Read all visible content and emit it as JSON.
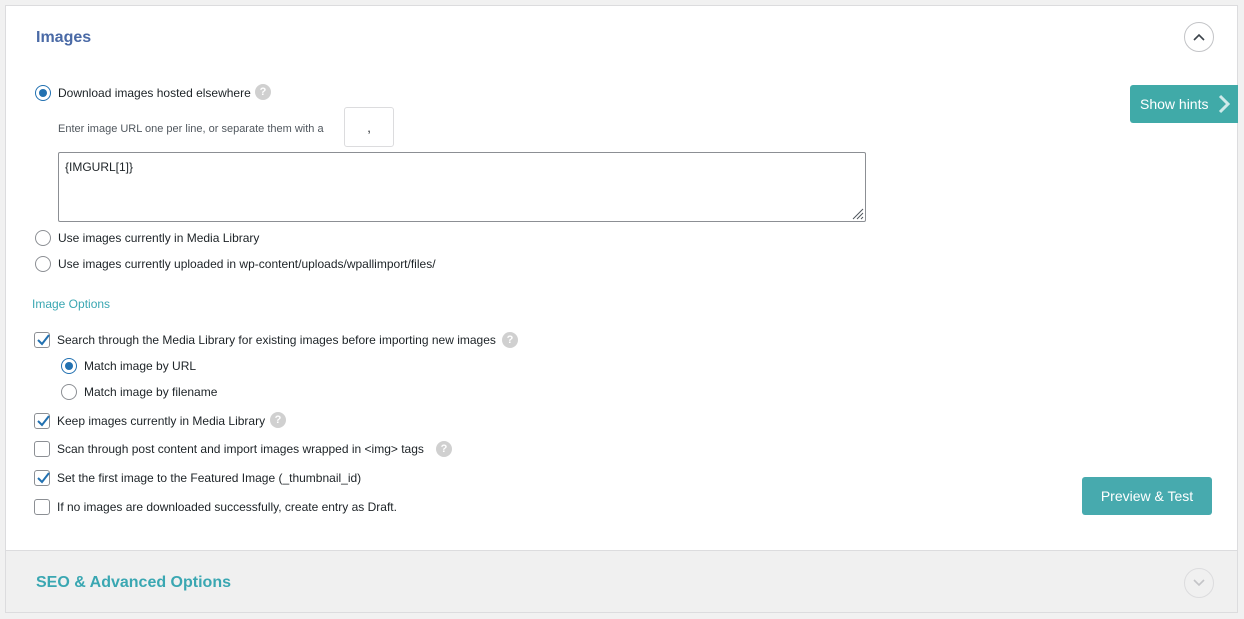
{
  "images_panel": {
    "title": "Images",
    "source_options": {
      "download_label": "Download images hosted elsewhere",
      "download_selected": true,
      "url_hint": "Enter image URL one per line, or separate them with a",
      "separator_value": ",",
      "urls_value": "{IMGURL[1]}",
      "media_library_label": "Use images currently in Media Library",
      "uploaded_label": "Use images currently uploaded in wp-content/uploads/wpallimport/files/"
    },
    "image_options": {
      "heading": "Image Options",
      "search_media_label": "Search through the Media Library for existing images before importing new images",
      "search_media_checked": true,
      "match_url_label": "Match image by URL",
      "match_url_selected": true,
      "match_filename_label": "Match image by filename",
      "keep_images_label": "Keep images currently in Media Library",
      "keep_images_checked": true,
      "scan_content_label": "Scan through post content and import images wrapped in <img> tags",
      "scan_content_checked": false,
      "featured_image_label": "Set the first image to the Featured Image (_thumbnail_id)",
      "featured_image_checked": true,
      "draft_label": "If no images are downloaded successfully, create entry as Draft.",
      "draft_checked": false
    },
    "help_glyph": "?"
  },
  "show_hints": {
    "label": "Show hints"
  },
  "preview_button": {
    "label": "Preview & Test"
  },
  "seo_panel": {
    "title": "SEO & Advanced Options"
  },
  "icons": [
    "chevron-up-icon",
    "chevron-down-icon",
    "chevron-right-icon",
    "question-mark-icon",
    "checkmark-icon",
    "resize-grip-icon"
  ],
  "colors": {
    "accent": "#40aaa8",
    "title": "#4a6aa6",
    "radio": "#2271b1",
    "section": "#3aa7b2"
  }
}
